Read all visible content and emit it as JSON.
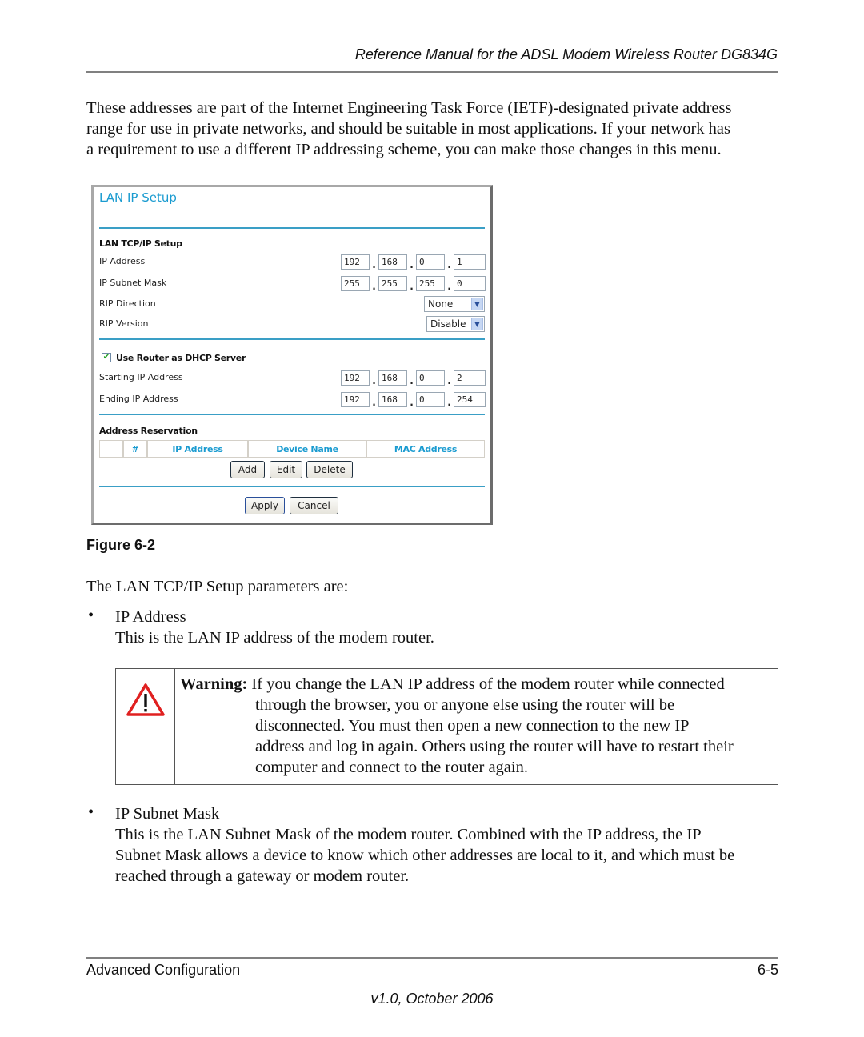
{
  "header": {
    "title": "Reference Manual for the ADSL Modem Wireless Router DG834G"
  },
  "intro_paragraph": {
    "lines": [
      "These addresses are part of the Internet Engineering Task Force (IETF)-designated private address",
      "range for use in private networks, and should be suitable in most applications. If your network has",
      "a requirement to use a different IP addressing scheme, you can make those changes in this menu."
    ]
  },
  "figure": {
    "caption": "Figure 6-2",
    "ui": {
      "title": "LAN IP Setup",
      "tcpip_section": {
        "heading": "LAN TCP/IP Setup",
        "ip_address": {
          "label": "IP Address",
          "octets": [
            "192",
            "168",
            "0",
            "1"
          ]
        },
        "subnet_mask": {
          "label": "IP Subnet Mask",
          "octets": [
            "255",
            "255",
            "255",
            "0"
          ]
        },
        "rip_direction": {
          "label": "RIP Direction",
          "value": "None"
        },
        "rip_version": {
          "label": "RIP Version",
          "value": "Disable"
        }
      },
      "dhcp_section": {
        "checkbox_label": "Use Router as DHCP Server",
        "checked": true,
        "checkmark": "✔",
        "starting_ip": {
          "label": "Starting IP Address",
          "octets": [
            "192",
            "168",
            "0",
            "2"
          ]
        },
        "ending_ip": {
          "label": "Ending IP Address",
          "octets": [
            "192",
            "168",
            "0",
            "254"
          ]
        }
      },
      "reservation_section": {
        "heading": "Address Reservation",
        "columns": [
          "",
          "#",
          "IP Address",
          "Device Name",
          "MAC Address"
        ],
        "buttons": {
          "add": "Add",
          "edit": "Edit",
          "delete": "Delete"
        }
      },
      "footer_buttons": {
        "apply": "Apply",
        "cancel": "Cancel"
      },
      "colors": {
        "accent": "#1a9bd0",
        "rule": "#3a9fc6"
      },
      "dot": "."
    }
  },
  "params_intro": "The LAN TCP/IP Setup parameters are:",
  "bullet_glyph": "•",
  "ip_address_item": {
    "term": "IP Address",
    "description": "This is the LAN IP address of the modem router."
  },
  "warning": {
    "icon": "warning-triangle-icon",
    "label": "Warning:",
    "lines": [
      " If you change the LAN IP address of the modem router while connected",
      "through the browser, you or anyone else using the router will be",
      "disconnected. You must then open a new connection to the new IP",
      "address and log in again. Others using the router will have to restart their",
      "computer and connect to the router again."
    ],
    "color": "#e02020"
  },
  "subnet_mask_item": {
    "term": "IP Subnet Mask",
    "description_lines": [
      "This is the LAN Subnet Mask of the modem router. Combined with the IP address, the IP",
      "Subnet Mask allows a device to know which other addresses are local to it, and which must be",
      "reached through a gateway or modem router."
    ]
  },
  "footer": {
    "section": "Advanced Configuration",
    "page": "6-5",
    "version": "v1.0, October 2006"
  }
}
